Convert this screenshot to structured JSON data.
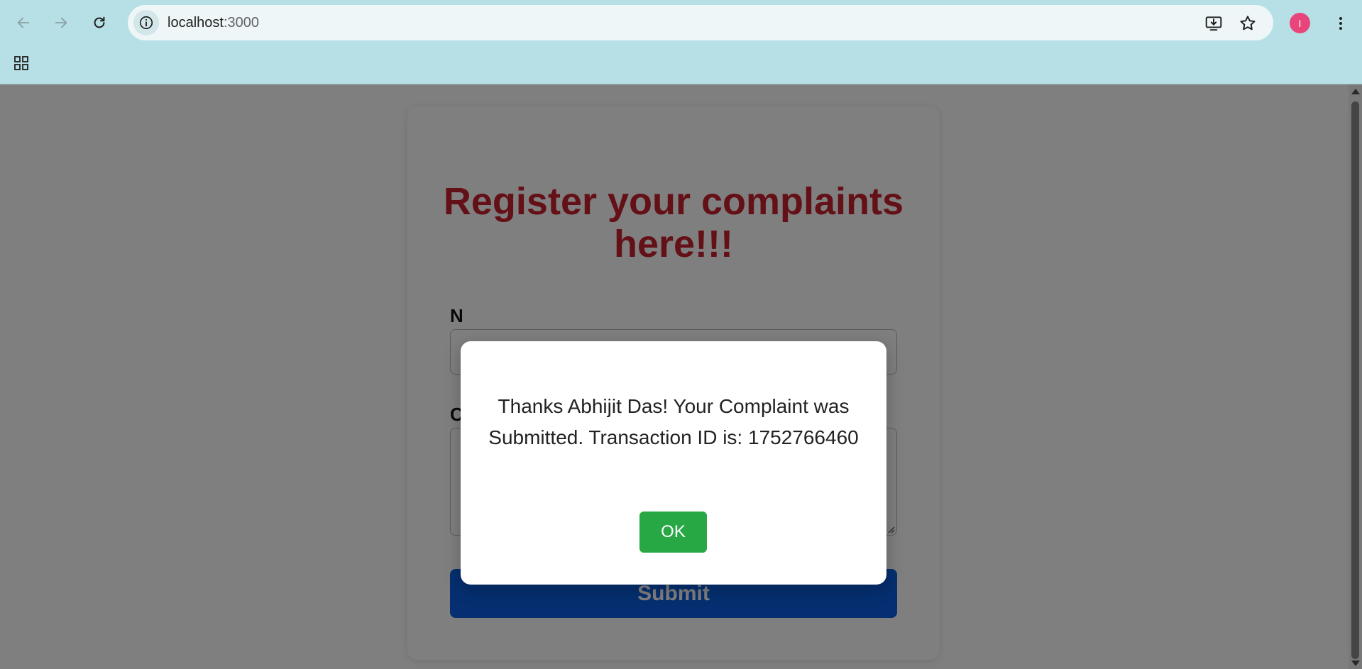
{
  "browser": {
    "url_host": "localhost",
    "url_port": ":3000",
    "avatar_initial": "I",
    "icons": {
      "back": "arrow-left-icon",
      "forward": "arrow-right-icon",
      "reload": "reload-icon",
      "site_info": "info-icon",
      "install": "install-app-icon",
      "bookmark": "star-icon",
      "menu": "kebab-menu-icon",
      "apps": "apps-grid-icon"
    },
    "chrome_color": "#b7e0e6",
    "avatar_color": "#e8457b"
  },
  "form": {
    "title": "Register your complaints here!!!",
    "name_label": "N",
    "complaint_label": "C",
    "submit_label": "Submit",
    "title_color": "#c8202f",
    "submit_color": "#0a5fe0"
  },
  "modal": {
    "message": "Thanks Abhijit Das! Your Complaint was Submitted. Transaction ID is: 1752766460",
    "ok_label": "OK",
    "ok_color": "#28a745"
  }
}
